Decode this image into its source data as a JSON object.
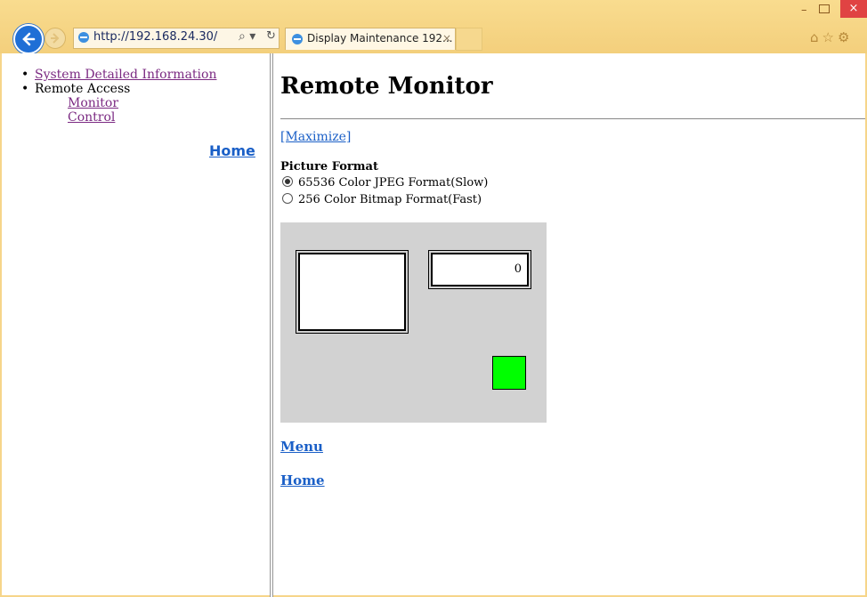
{
  "browser": {
    "url": "http://192.168.24.30/",
    "tab_title": "Display Maintenance 192...",
    "tab_close": "×",
    "minimize": "–",
    "close": "×",
    "toolbar_icons": "⌂☆⚙"
  },
  "left_nav": {
    "items": [
      {
        "label": "System Detailed Information",
        "link": true
      },
      {
        "label": "Remote Access",
        "link": false
      }
    ],
    "sub_items": [
      "Monitor",
      "Control"
    ],
    "bullet": "•",
    "home": "Home"
  },
  "main": {
    "title": "Remote Monitor",
    "maximize": "[Maximize]",
    "picture_format_label": "Picture Format",
    "options": [
      {
        "label": "65536 Color JPEG Format(Slow)",
        "selected": true
      },
      {
        "label": "256 Color Bitmap Format(Fast)",
        "selected": false
      }
    ],
    "counter_value": "0",
    "indicator_color": "#00ff00",
    "menu_link": "Menu",
    "home_link": "Home"
  }
}
